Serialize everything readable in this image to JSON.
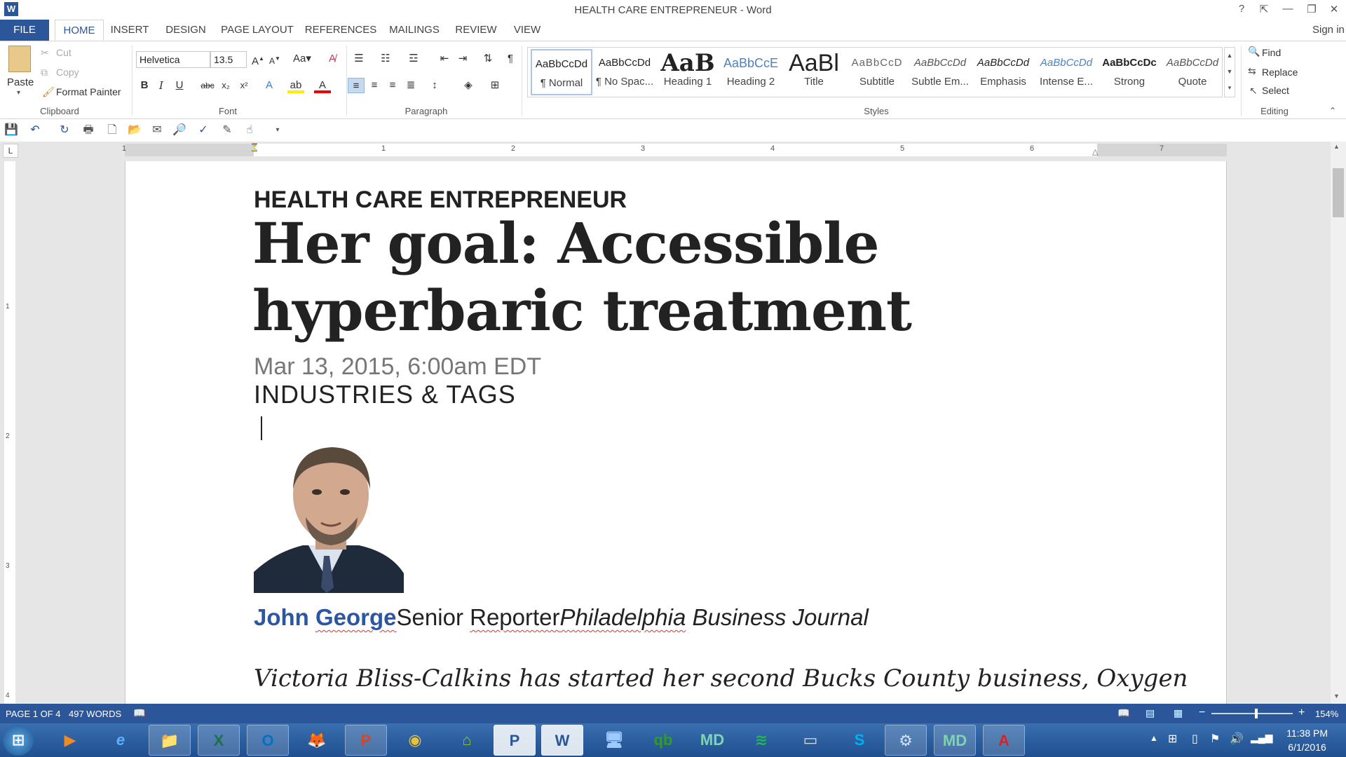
{
  "window": {
    "title": "HEALTH CARE ENTREPRENEUR - Word",
    "help": "?",
    "sign_in": "Sign in"
  },
  "tabs": [
    "FILE",
    "HOME",
    "INSERT",
    "DESIGN",
    "PAGE LAYOUT",
    "REFERENCES",
    "MAILINGS",
    "REVIEW",
    "VIEW"
  ],
  "clipboard": {
    "paste": "Paste",
    "cut": "Cut",
    "copy": "Copy",
    "format_painter": "Format Painter",
    "label": "Clipboard"
  },
  "font": {
    "family": "Helvetica",
    "size": "13.5",
    "label": "Font"
  },
  "paragraph": {
    "label": "Paragraph"
  },
  "styles": {
    "label": "Styles",
    "items": [
      {
        "preview": "AaBbCcDd",
        "name": "¶ Normal"
      },
      {
        "preview": "AaBbCcDd",
        "name": "¶ No Spac..."
      },
      {
        "preview": "AaB",
        "name": "Heading 1"
      },
      {
        "preview": "AaBbCcE",
        "name": "Heading 2"
      },
      {
        "preview": "AaBl",
        "name": "Title"
      },
      {
        "preview": "AaBbCcD",
        "name": "Subtitle"
      },
      {
        "preview": "AaBbCcDd",
        "name": "Subtle Em..."
      },
      {
        "preview": "AaBbCcDd",
        "name": "Emphasis"
      },
      {
        "preview": "AaBbCcDd",
        "name": "Intense E..."
      },
      {
        "preview": "AaBbCcDc",
        "name": "Strong"
      },
      {
        "preview": "AaBbCcDd",
        "name": "Quote"
      }
    ]
  },
  "editing": {
    "find": "Find",
    "replace": "Replace",
    "select": "Select",
    "label": "Editing"
  },
  "ruler": {
    "h_numbers": [
      "1",
      "1",
      "2",
      "3",
      "4",
      "5",
      "6",
      "7"
    ],
    "v_numbers": [
      "1",
      "2",
      "3",
      "4"
    ],
    "corner": "L"
  },
  "document": {
    "section": "HEALTH CARE ENTREPRENEUR",
    "headline_line1": "Her goal: Accessible",
    "headline_line2": "hyperbaric treatment",
    "date": "Mar 13, 2015, 6:00am EDT",
    "tags": "INDUSTRIES & TAGS",
    "author_first": "John ",
    "author_last": "George",
    "role_a": "Senior ",
    "role_b": "Reporter",
    "pub_a": "Philadelphia",
    "pub_b": " Business Journal",
    "body": "Victoria Bliss-Calkins has started her second Bucks County business, Oxygen"
  },
  "status": {
    "page": "PAGE 1 OF 4",
    "words": "497 WORDS",
    "zoom": "154%"
  },
  "taskbar": {
    "time": "11:38 PM",
    "date": "6/1/2016"
  },
  "colors": {
    "word_blue": "#2b579a",
    "author_blue": "#2a56a3"
  }
}
